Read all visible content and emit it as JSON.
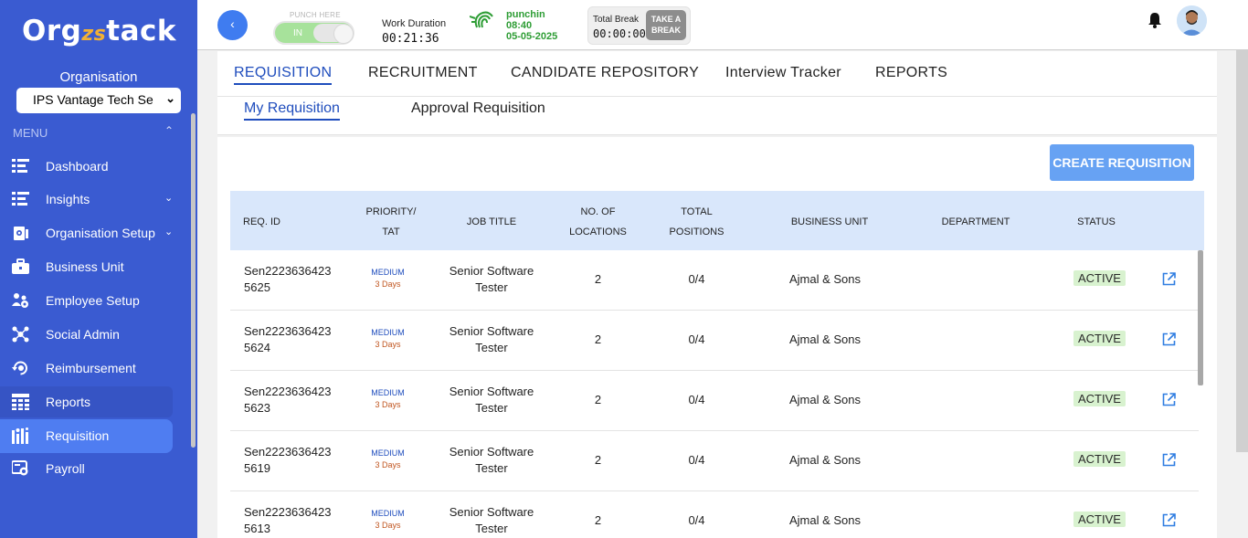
{
  "sidebar": {
    "logo_main": "Org",
    "logo_accent": "zs",
    "logo_end": "tack",
    "org_label": "Organisation",
    "org_selected": "IPS Vantage Tech Se",
    "menu_label": "MENU",
    "items": [
      {
        "label": "Dashboard",
        "icon": "dashboard-icon",
        "chevron": false
      },
      {
        "label": "Insights",
        "icon": "insights-icon",
        "chevron": true
      },
      {
        "label": "Organisation Setup",
        "icon": "org-setup-icon",
        "chevron": true
      },
      {
        "label": "Business Unit",
        "icon": "briefcase-icon",
        "chevron": false
      },
      {
        "label": "Employee Setup",
        "icon": "employee-icon",
        "chevron": false
      },
      {
        "label": "Social Admin",
        "icon": "social-icon",
        "chevron": false
      },
      {
        "label": "Reimbursement",
        "icon": "reimbursement-icon",
        "chevron": false
      },
      {
        "label": "Reports",
        "icon": "reports-icon",
        "chevron": false
      },
      {
        "label": "Requisition",
        "icon": "requisition-icon",
        "chevron": false,
        "active": true
      },
      {
        "label": "Payroll",
        "icon": "payroll-icon",
        "chevron": false
      }
    ]
  },
  "header": {
    "punch_label": "PUNCH HERE",
    "punch_state": "IN",
    "work_duration_label": "Work Duration",
    "work_duration_value": "00:21:36",
    "punchin_label": "punchin",
    "punchin_time": "08:40",
    "punchin_date": "05-05-2025",
    "total_break_label": "Total Break",
    "total_break_value": "00:00:00",
    "take_break_line1": "TAKE A",
    "take_break_line2": "BREAK"
  },
  "tabs": [
    "REQUISITION",
    "RECRUITMENT",
    "CANDIDATE REPOSITORY",
    "Interview Tracker",
    "REPORTS"
  ],
  "subtabs": [
    "My Requisition",
    "Approval Requisition"
  ],
  "create_button": "CREATE REQUISITION",
  "table": {
    "headers": {
      "req_id": "REQ. ID",
      "priority_1": "PRIORITY/",
      "priority_2": "TAT",
      "job_title": "JOB TITLE",
      "locations_1": "NO. OF",
      "locations_2": "LOCATIONS",
      "positions_1": "TOTAL",
      "positions_2": "POSITIONS",
      "business_unit": "BUSINESS UNIT",
      "department": "DEPARTMENT",
      "status": "STATUS"
    },
    "rows": [
      {
        "id1": "Sen2223636423",
        "id2": "5625",
        "priority": "MEDIUM",
        "tat": "3 Days",
        "job1": "Senior Software",
        "job2": "Tester",
        "locations": "2",
        "positions": "0/4",
        "bu": "Ajmal & Sons",
        "department": "",
        "status": "ACTIVE"
      },
      {
        "id1": "Sen2223636423",
        "id2": "5624",
        "priority": "MEDIUM",
        "tat": "3 Days",
        "job1": "Senior Software",
        "job2": "Tester",
        "locations": "2",
        "positions": "0/4",
        "bu": "Ajmal & Sons",
        "department": "",
        "status": "ACTIVE"
      },
      {
        "id1": "Sen2223636423",
        "id2": "5623",
        "priority": "MEDIUM",
        "tat": "3 Days",
        "job1": "Senior Software",
        "job2": "Tester",
        "locations": "2",
        "positions": "0/4",
        "bu": "Ajmal & Sons",
        "department": "",
        "status": "ACTIVE"
      },
      {
        "id1": "Sen2223636423",
        "id2": "5619",
        "priority": "MEDIUM",
        "tat": "3 Days",
        "job1": "Senior Software",
        "job2": "Tester",
        "locations": "2",
        "positions": "0/4",
        "bu": "Ajmal & Sons",
        "department": "",
        "status": "ACTIVE"
      },
      {
        "id1": "Sen2223636423",
        "id2": "5613",
        "priority": "MEDIUM",
        "tat": "3 Days",
        "job1": "Senior Software",
        "job2": "Tester",
        "locations": "2",
        "positions": "0/4",
        "bu": "Ajmal & Sons",
        "department": "",
        "status": "ACTIVE"
      }
    ]
  },
  "colors": {
    "sidebar_bg": "#3a5bd1",
    "active_item": "#4f7df1",
    "accent_blue": "#1f4dbd",
    "create_button": "#67a2f3",
    "table_header": "#d9e7fb",
    "status_bg": "#d8f2cf",
    "punch_green": "#2e9d35"
  }
}
